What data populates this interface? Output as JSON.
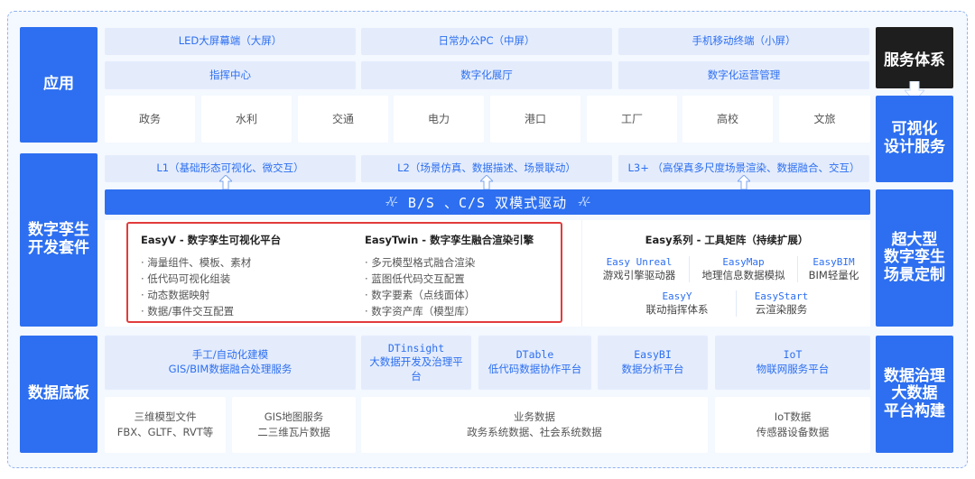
{
  "sidebar_left": {
    "app": "应用",
    "dev_kit": "数字孪生\n开发套件",
    "data_base": "数据底板"
  },
  "sidebar_right": {
    "service_system": "服务体系",
    "vis_service": "可视化\n设计服务",
    "large_scene": "超大型\n数字孪生\n场景定制",
    "data_gov": "数据治理\n大数据\n平台构建"
  },
  "app_layer": {
    "screens": [
      "LED大屏幕端（大屏）",
      "日常办公PC（中屏）",
      "手机移动终端（小屏）"
    ],
    "centers": [
      "指挥中心",
      "数字化展厅",
      "数字化运营管理"
    ],
    "industries": [
      "政务",
      "水利",
      "交通",
      "电力",
      "港口",
      "工厂",
      "高校",
      "文旅"
    ]
  },
  "levels": [
    "L1（基础形态可视化、微交互）",
    "L2（场景仿真、数据描述、场景联动）",
    "L3+ （高保真多尺度场景渲染、数据融合、交互）"
  ],
  "band": {
    "wave": "-⁄\\⁄-",
    "label": "B/S 、C/S 双模式驱动"
  },
  "easyv": {
    "title": "EasyV - 数字孪生可视化平台",
    "items": [
      "· 海量组件、模板、素材",
      "· 低代码可视化组装",
      "· 动态数据映射",
      "· 数据/事件交互配置"
    ]
  },
  "easytwin": {
    "title": "EasyTwin - 数字孪生融合渲染引擎",
    "items": [
      "· 多元模型格式融合渲染",
      "· 蓝图低代码交互配置",
      "· 数字要素（点线面体）",
      "· 数字资产库（模型库）"
    ]
  },
  "easy_series": {
    "title": "Easy系列 - 工具矩阵（持续扩展）",
    "tools": [
      {
        "name": "Easy Unreal",
        "desc": "游戏引擎驱动器"
      },
      {
        "name": "EasyMap",
        "desc": "地理信息数据模拟"
      },
      {
        "name": "EasyBIM",
        "desc": "BIM轻量化"
      },
      {
        "name": "EasyY",
        "desc": "联动指挥体系"
      },
      {
        "name": "EasyStart",
        "desc": "云渲染服务"
      }
    ]
  },
  "data_layer": {
    "modeling": {
      "line1": "手工/自动化建模",
      "line2": "GIS/BIM数据融合处理服务"
    },
    "dtinsight": {
      "name": "DTinsight",
      "desc": "大数据开发及治理平\n台"
    },
    "dtable": {
      "name": "DTable",
      "desc": "低代码数据协作平台"
    },
    "easybi": {
      "name": "EasyBI",
      "desc": "数据分析平台"
    },
    "iot": {
      "name": "IoT",
      "desc": "物联网服务平台"
    },
    "model_files": {
      "line1": "三维模型文件",
      "line2": "FBX、GLTF、RVT等"
    },
    "gis": {
      "line1": "GIS地图服务",
      "line2": "二三维瓦片数据"
    },
    "business": {
      "line1": "业务数据",
      "line2": "政务系统数据、社会系统数据"
    },
    "iot_data": {
      "line1": "IoT数据",
      "line2": "传感器设备数据"
    }
  },
  "colors": {
    "accent": "#2d6ff0",
    "light": "#e4ecfc",
    "highlight": "#e23b3b",
    "dark": "#1e1e1e"
  }
}
